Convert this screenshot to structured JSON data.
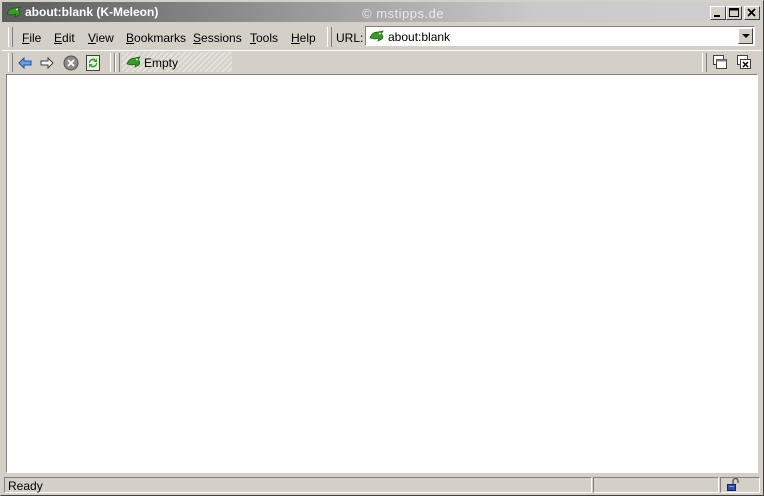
{
  "window": {
    "title": "about:blank (K-Meleon)",
    "watermark": "© mstipps.de"
  },
  "menu": {
    "items": [
      {
        "key": "F",
        "rest": "ile"
      },
      {
        "key": "E",
        "rest": "dit"
      },
      {
        "key": "V",
        "rest": "iew"
      },
      {
        "key": "B",
        "rest": "ookmarks"
      },
      {
        "key": "S",
        "rest": "essions"
      },
      {
        "key": "T",
        "rest": "ools"
      },
      {
        "key": "H",
        "rest": "elp"
      }
    ]
  },
  "url": {
    "label": "URL:",
    "value": "about:blank"
  },
  "bookmarks": {
    "label": "Empty"
  },
  "status": {
    "text": "Ready"
  },
  "icons": {
    "back": "back-arrow-icon",
    "forward": "forward-arrow-icon",
    "stop": "stop-icon",
    "reload": "reload-icon",
    "layer_new": "new-layer-icon",
    "layer_close": "close-layer-icon",
    "security": "unlocked-padlock-icon"
  },
  "colors": {
    "logo_green": "#3a9a2a",
    "nav_blue": "#2050a0"
  }
}
